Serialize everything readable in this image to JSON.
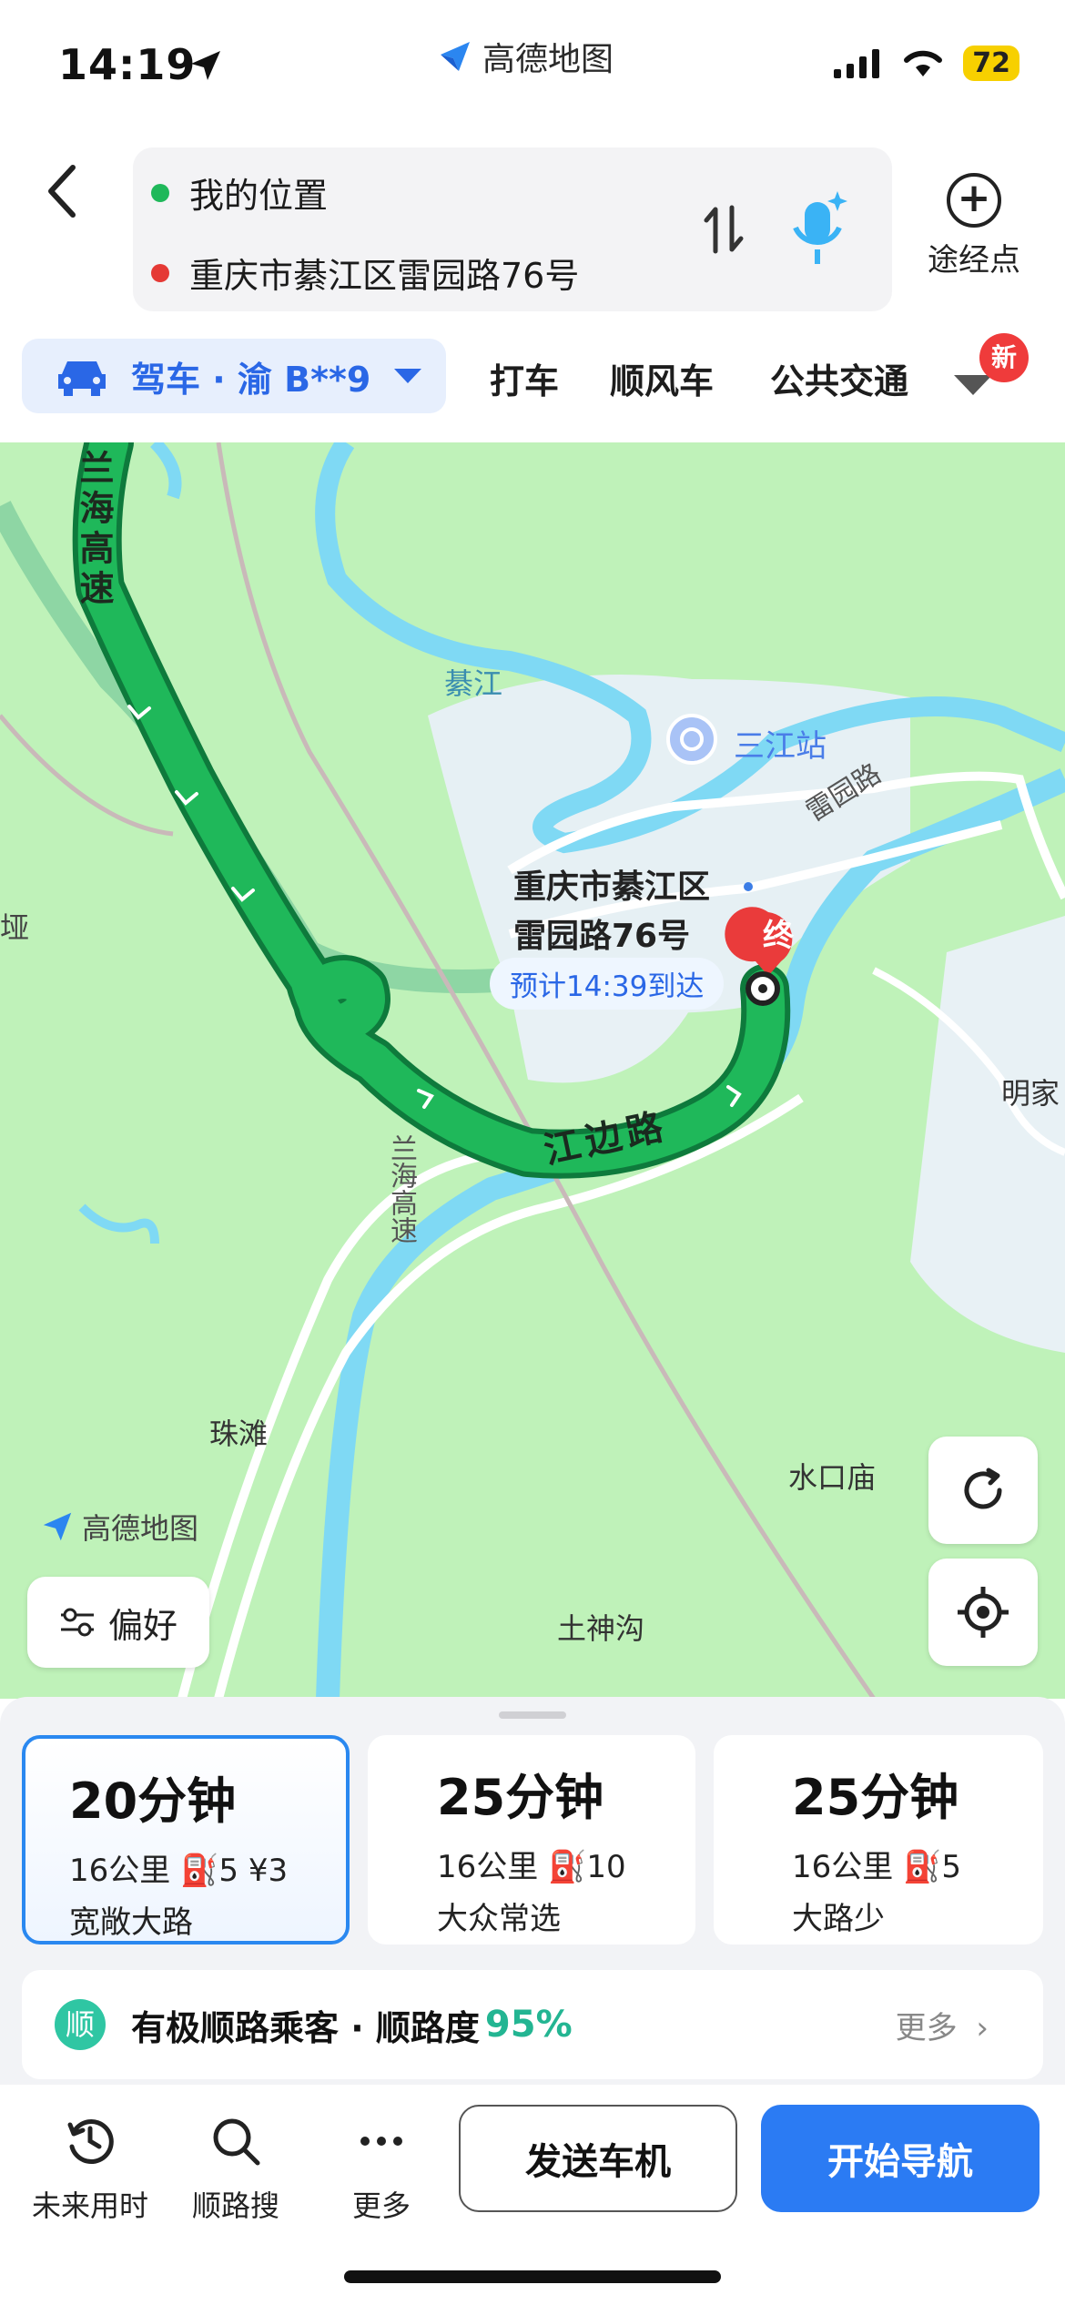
{
  "status": {
    "time": "14:19",
    "app_name": "高德地图",
    "battery": "72"
  },
  "route": {
    "origin": "我的位置",
    "destination": "重庆市綦江区雷园路76号",
    "waypoint_label": "途经点"
  },
  "modes": {
    "drive": "驾车 · 渝 B**9",
    "taxi": "打车",
    "carpool": "顺风车",
    "transit": "公共交通",
    "new_badge": "新"
  },
  "map": {
    "labels": {
      "highway_top": "兰海高速",
      "river": "綦江",
      "station": "三江站",
      "leiyuan_road": "雷园路",
      "yazi": "垭",
      "jiangbian_road": "江边路",
      "highway_bottom": "兰海高速",
      "mingjia": "明家",
      "zhutan": "珠滩",
      "shuikou": "水口庙",
      "tushengou": "土神沟"
    },
    "destination_line1": "重庆市綦江区",
    "destination_line2": "雷园路76号",
    "end_marker": "终",
    "eta": "预计14:39到达",
    "watermark": "高德地图",
    "preference_button": "偏好"
  },
  "routes": [
    {
      "time": "20分钟",
      "details": "16公里  ⛽5  ¥3",
      "tag": "宽敞大路"
    },
    {
      "time": "25分钟",
      "details": "16公里  ⛽10",
      "tag": "大众常选"
    },
    {
      "time": "25分钟",
      "details": "16公里  ⛽5",
      "tag": "大路少"
    }
  ],
  "carpool": {
    "icon": "顺",
    "text": "有极顺路乘客 · 顺路度",
    "percent": "95%",
    "more": "更多"
  },
  "bottom_bar": {
    "future_time": "未来用时",
    "along_search": "顺路搜",
    "more": "更多",
    "send_to_car": "发送车机",
    "start_nav": "开始导航"
  },
  "colors": {
    "accent": "#2b7bf3",
    "route_green": "#1fb85a",
    "map_bg": "#bff2b9",
    "river": "#7fd9f4"
  }
}
